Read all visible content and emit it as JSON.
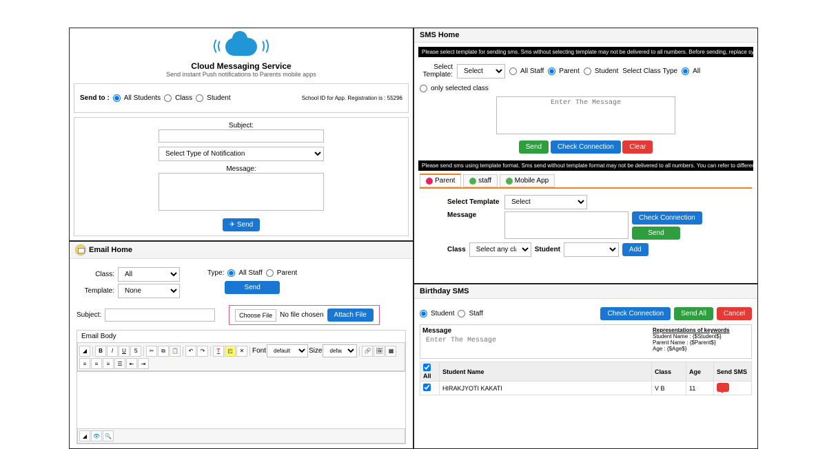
{
  "cloud": {
    "title": "Cloud Messaging Service",
    "subtitle": "Send instant Push notifications to Parents mobile apps",
    "send_to_label": "Send to :",
    "opt_all_students": "All Students",
    "opt_class": "Class",
    "opt_student": "Student",
    "school_id_text": "School ID for App. Registration is : 55296",
    "subject_label": "Subject:",
    "notif_placeholder": "Select Type of Notification",
    "message_label": "Message:",
    "send_btn": "✈ Send"
  },
  "email": {
    "header": "Email Home",
    "class_label": "Class:",
    "class_value": "All",
    "template_label": "Template:",
    "template_value": "None",
    "type_label": "Type:",
    "type_allstaff": "All Staff",
    "type_parent": "Parent",
    "send_btn": "Send",
    "choose_file": "Choose File",
    "no_file": "No file chosen",
    "attach_btn": "Attach File",
    "subject_label": "Subject:",
    "body_label": "Email Body",
    "font_label": "Font",
    "font_value": "default",
    "size_label": "Size",
    "size_value": "default"
  },
  "sms": {
    "header": "SMS Home",
    "warn1": "Please select template for sending sms. Sms without selecting template may not be delivered to all numbers. Before sending, replace symbol ($ $) parts with c",
    "select_template_label": "Select Template:",
    "select_value": "Select",
    "opt_allstaff": "All Staff",
    "opt_parent": "Parent",
    "opt_student": "Student",
    "class_type_label": "Select Class Type",
    "opt_all": "All",
    "opt_selected": "only selected class",
    "msg_placeholder": "Enter The Message",
    "send_btn": "Send",
    "check_btn": "Check Connection",
    "clear_btn": "Clear",
    "warn2": "Please send sms using template format. Sms send without template format may not be delivered to all numbers. You can refer to different temp",
    "tab_parent": "Parent",
    "tab_staff": "staff",
    "tab_mobile": "Mobile App",
    "sel_template2": "Select Template",
    "message_label": "Message",
    "class2_label": "Class",
    "class2_value": "Select any class",
    "student2_label": "Student",
    "add_btn": "Add"
  },
  "bday": {
    "header": "Birthday SMS",
    "opt_student": "Student",
    "opt_staff": "Staff",
    "check_btn": "Check Connection",
    "sendall_btn": "Send All",
    "cancel_btn": "Cancel",
    "message_label": "Message",
    "msg_placeholder": "Enter The Message",
    "rep_header": "Representations of keywords",
    "rep_sname_l": "Student Name :",
    "rep_sname_v": "{$Student$}",
    "rep_pname_l": "Parent Name :",
    "rep_pname_v": "{$Parent$}",
    "rep_age_l": "Age :",
    "rep_age_v": "{$Age$}",
    "th_all": "All",
    "th_name": "Student Name",
    "th_class": "Class",
    "th_age": "Age",
    "th_send": "Send SMS",
    "row1_name": "HIRAKJYOTI KAKATI",
    "row1_class": "V B",
    "row1_age": "11"
  }
}
